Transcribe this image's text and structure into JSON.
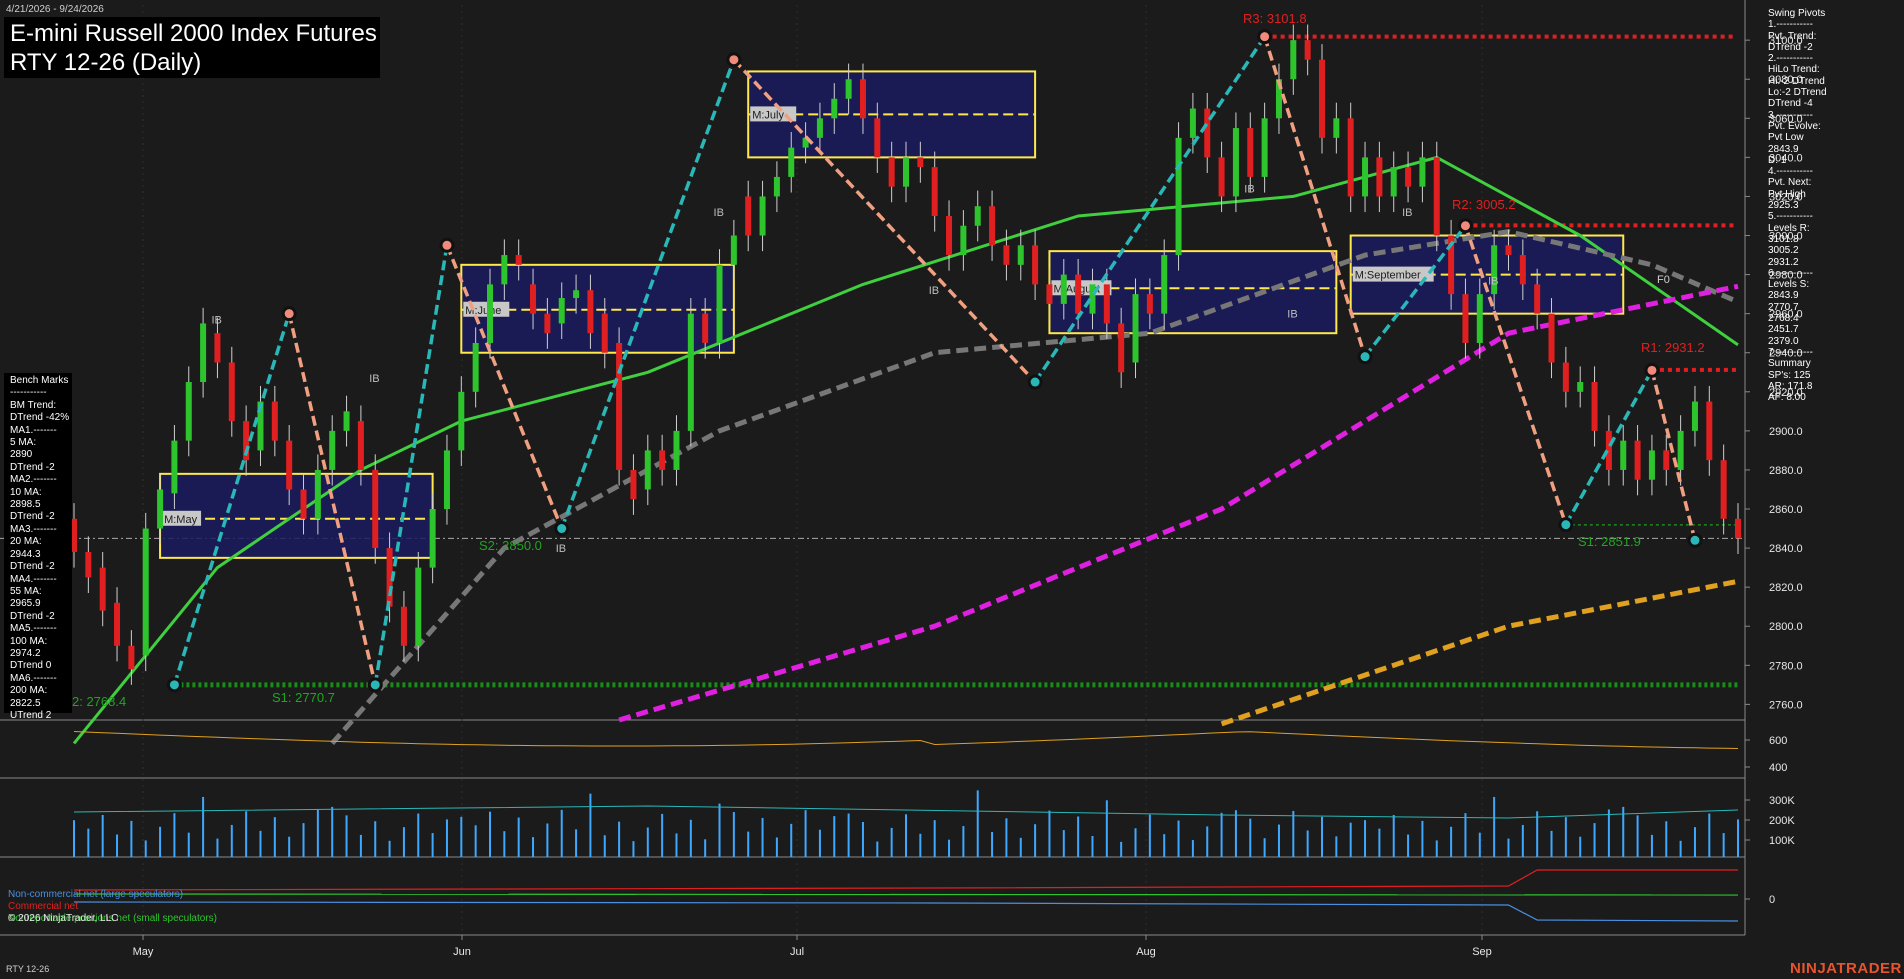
{
  "header": {
    "date_range": "4/21/2026 - 9/24/2026",
    "title_line1": "E-mini Russell 2000 Index Futures",
    "title_line2": "RTY 12-26 (Daily)"
  },
  "benchmarks": {
    "title": "Bench Marks",
    "lines": [
      "-----------",
      "BM Trend:",
      "DTrend -42%",
      "MA1.-------",
      "5 MA:",
      "2890",
      "DTrend -2",
      "MA2.-------",
      "10 MA:",
      "2898.5",
      "DTrend -2",
      "MA3.-------",
      "20 MA:",
      "2944.3",
      "DTrend -2",
      "MA4.-------",
      "55 MA:",
      "2965.9",
      "DTrend -2",
      "MA5.-------",
      "100 MA:",
      "2974.2",
      "DTrend 0",
      "MA6.-------",
      "200 MA:",
      "2822.5",
      "UTrend 2"
    ]
  },
  "swing_pivots": {
    "lines": [
      "Swing Pivots",
      "1.-----------",
      "Pvt. Trend:",
      "DTrend -2",
      "2.-----------",
      "HiLo Trend:",
      "Hi:-2 DTrend",
      "Lo:-2 DTrend",
      "DTrend -4",
      "3.-----------",
      "Pvt. Evolve:",
      "Pvt Low",
      "2843.9",
      "D: 1",
      "4.-----------",
      "Pvt. Next:",
      "Pvt High",
      "2925.3",
      "5.-----------",
      "Levels R:",
      "3101.8",
      "3005.2",
      "2931.2",
      "6.-----------",
      "Levels S:",
      "2843.9",
      "2770.7",
      "2768.4",
      "2451.7",
      "2379.0",
      "7.-----------",
      "Summary",
      "SP's: 125",
      "AR: 171.8",
      "AF: 8.00"
    ]
  },
  "level_labels": {
    "r3": "R3: 3101.8",
    "r2": "R2: 3005.2",
    "r1": "R1: 2931.2",
    "s2": "S2: 2850.0",
    "s1_left": "S1: 2770.7",
    "s2_left": "2: 2768.4",
    "s1_right": "S1: 2851.9"
  },
  "month_boxes": [
    "M:May",
    "M:June",
    "M:July",
    "M:August",
    "M:September"
  ],
  "markers": {
    "ib": "IB",
    "f0": "F0"
  },
  "x_axis": [
    "May",
    "Jun",
    "Jul",
    "Aug",
    "Sep"
  ],
  "price_axis": [
    "3100.0",
    "3080.0",
    "3060.0",
    "3040.0",
    "3020.0",
    "3000.0",
    "2980.0",
    "2960.0",
    "2940.0",
    "2920.0",
    "2900.0",
    "2880.0",
    "2860.0",
    "2840.0",
    "2820.0",
    "2800.0",
    "2780.0",
    "2760.0"
  ],
  "panel2_axis": [
    "600",
    "400"
  ],
  "panel3_axis": [
    "300K",
    "200K",
    "100K"
  ],
  "panel4_axis": [
    "0"
  ],
  "legend": {
    "noncommercial": "Non-commercial net (large speculators)",
    "commercial": "Commercial net",
    "nonreportable": "Nonreportable positions net (small speculators)"
  },
  "copyright": "© 2026 NinjaTrader, LLC",
  "footer_symbol": "RTY 12-26",
  "brand": "NINJATRADER",
  "colors": {
    "up": "#2ec42e",
    "down": "#e02020",
    "pivot_up": "#2ab7b7",
    "pivot_down": "#f0a080",
    "ma20": "#3fcf3f",
    "ma55": "#777777",
    "ma100": "#e020e0",
    "ma200": "#e0a020",
    "resistance": "#e02020",
    "support": "#1a8c1a",
    "box": "#ffe94a"
  },
  "chart_data": {
    "type": "candlestick",
    "title": "E-mini Russell 2000 Index Futures RTY 12-26 (Daily)",
    "x_range": [
      "2026-04-21",
      "2026-09-24"
    ],
    "ylim": [
      2752,
      3118
    ],
    "candles": [
      {
        "o": 2855,
        "c": 2838
      },
      {
        "o": 2838,
        "c": 2825
      },
      {
        "o": 2830,
        "c": 2808
      },
      {
        "o": 2812,
        "c": 2790
      },
      {
        "o": 2790,
        "c": 2778
      },
      {
        "o": 2785,
        "c": 2850
      },
      {
        "o": 2850,
        "c": 2870
      },
      {
        "o": 2868,
        "c": 2895
      },
      {
        "o": 2895,
        "c": 2925
      },
      {
        "o": 2925,
        "c": 2955
      },
      {
        "o": 2950,
        "c": 2935
      },
      {
        "o": 2935,
        "c": 2905
      },
      {
        "o": 2905,
        "c": 2885
      },
      {
        "o": 2890,
        "c": 2915
      },
      {
        "o": 2915,
        "c": 2895
      },
      {
        "o": 2895,
        "c": 2870
      },
      {
        "o": 2870,
        "c": 2855
      },
      {
        "o": 2855,
        "c": 2880
      },
      {
        "o": 2880,
        "c": 2900
      },
      {
        "o": 2900,
        "c": 2910
      },
      {
        "o": 2905,
        "c": 2880
      },
      {
        "o": 2880,
        "c": 2840
      },
      {
        "o": 2840,
        "c": 2810
      },
      {
        "o": 2810,
        "c": 2790
      },
      {
        "o": 2790,
        "c": 2830
      },
      {
        "o": 2830,
        "c": 2860
      },
      {
        "o": 2860,
        "c": 2890
      },
      {
        "o": 2890,
        "c": 2920
      },
      {
        "o": 2920,
        "c": 2945
      },
      {
        "o": 2945,
        "c": 2975
      },
      {
        "o": 2975,
        "c": 2990
      },
      {
        "o": 2990,
        "c": 2985
      },
      {
        "o": 2975,
        "c": 2960
      },
      {
        "o": 2960,
        "c": 2950
      },
      {
        "o": 2955,
        "c": 2968
      },
      {
        "o": 2968,
        "c": 2972
      },
      {
        "o": 2972,
        "c": 2950
      },
      {
        "o": 2960,
        "c": 2940
      },
      {
        "o": 2945,
        "c": 2880
      },
      {
        "o": 2880,
        "c": 2865
      },
      {
        "o": 2870,
        "c": 2890
      },
      {
        "o": 2890,
        "c": 2880
      },
      {
        "o": 2880,
        "c": 2900
      },
      {
        "o": 2900,
        "c": 2960
      },
      {
        "o": 2960,
        "c": 2945
      },
      {
        "o": 2945,
        "c": 2985
      },
      {
        "o": 2985,
        "c": 3000
      },
      {
        "o": 3020,
        "c": 3000
      },
      {
        "o": 3000,
        "c": 3020
      },
      {
        "o": 3020,
        "c": 3030
      },
      {
        "o": 3030,
        "c": 3045
      },
      {
        "o": 3045,
        "c": 3050
      },
      {
        "o": 3050,
        "c": 3060
      },
      {
        "o": 3060,
        "c": 3070
      },
      {
        "o": 3070,
        "c": 3080
      },
      {
        "o": 3080,
        "c": 3060
      },
      {
        "o": 3060,
        "c": 3040
      },
      {
        "o": 3040,
        "c": 3025
      },
      {
        "o": 3025,
        "c": 3040
      },
      {
        "o": 3040,
        "c": 3035
      },
      {
        "o": 3035,
        "c": 3010
      },
      {
        "o": 3010,
        "c": 2990
      },
      {
        "o": 2990,
        "c": 3005
      },
      {
        "o": 3005,
        "c": 3015
      },
      {
        "o": 3015,
        "c": 2995
      },
      {
        "o": 2995,
        "c": 2985
      },
      {
        "o": 2985,
        "c": 2995
      },
      {
        "o": 2995,
        "c": 2975
      },
      {
        "o": 2975,
        "c": 2965
      },
      {
        "o": 2965,
        "c": 2980
      },
      {
        "o": 2980,
        "c": 2960
      },
      {
        "o": 2960,
        "c": 2975
      },
      {
        "o": 2975,
        "c": 2955
      },
      {
        "o": 2955,
        "c": 2930
      },
      {
        "o": 2935,
        "c": 2970
      },
      {
        "o": 2970,
        "c": 2960
      },
      {
        "o": 2960,
        "c": 2990
      },
      {
        "o": 2990,
        "c": 3050
      },
      {
        "o": 3050,
        "c": 3065
      },
      {
        "o": 3065,
        "c": 3040
      },
      {
        "o": 3040,
        "c": 3020
      },
      {
        "o": 3020,
        "c": 3055
      },
      {
        "o": 3055,
        "c": 3030
      },
      {
        "o": 3030,
        "c": 3060
      },
      {
        "o": 3060,
        "c": 3080
      },
      {
        "o": 3080,
        "c": 3100
      },
      {
        "o": 3100,
        "c": 3090
      },
      {
        "o": 3090,
        "c": 3050
      },
      {
        "o": 3050,
        "c": 3060
      },
      {
        "o": 3060,
        "c": 3020
      },
      {
        "o": 3020,
        "c": 3040
      },
      {
        "o": 3040,
        "c": 3020
      },
      {
        "o": 3020,
        "c": 3035
      },
      {
        "o": 3035,
        "c": 3025
      },
      {
        "o": 3025,
        "c": 3040
      },
      {
        "o": 3040,
        "c": 3000
      },
      {
        "o": 3000,
        "c": 2970
      },
      {
        "o": 2970,
        "c": 2945
      },
      {
        "o": 2945,
        "c": 2970
      },
      {
        "o": 2970,
        "c": 2995
      },
      {
        "o": 2995,
        "c": 2990
      },
      {
        "o": 2990,
        "c": 2975
      },
      {
        "o": 2975,
        "c": 2960
      },
      {
        "o": 2960,
        "c": 2935
      },
      {
        "o": 2935,
        "c": 2920
      },
      {
        "o": 2920,
        "c": 2925
      },
      {
        "o": 2925,
        "c": 2900
      },
      {
        "o": 2900,
        "c": 2880
      },
      {
        "o": 2880,
        "c": 2895
      },
      {
        "o": 2895,
        "c": 2875
      },
      {
        "o": 2875,
        "c": 2890
      },
      {
        "o": 2890,
        "c": 2880
      },
      {
        "o": 2880,
        "c": 2900
      },
      {
        "o": 2900,
        "c": 2915
      },
      {
        "o": 2915,
        "c": 2885
      },
      {
        "o": 2885,
        "c": 2855
      },
      {
        "o": 2855,
        "c": 2845
      }
    ],
    "moving_averages": [
      {
        "name": "20 MA",
        "color": "#3fcf3f",
        "points": [
          [
            0,
            2740
          ],
          [
            10,
            2830
          ],
          [
            20,
            2880
          ],
          [
            27,
            2905
          ],
          [
            40,
            2930
          ],
          [
            55,
            2975
          ],
          [
            70,
            3010
          ],
          [
            85,
            3020
          ],
          [
            95,
            3040
          ],
          [
            105,
            3000
          ],
          [
            116,
            2944
          ]
        ]
      },
      {
        "name": "55 MA",
        "color": "#777777",
        "points": [
          [
            18,
            2740
          ],
          [
            30,
            2840
          ],
          [
            45,
            2900
          ],
          [
            60,
            2940
          ],
          [
            75,
            2950
          ],
          [
            90,
            2990
          ],
          [
            100,
            3002
          ],
          [
            110,
            2985
          ],
          [
            116,
            2966
          ]
        ]
      },
      {
        "name": "100 MA",
        "color": "#e020e0",
        "points": [
          [
            38,
            2752
          ],
          [
            60,
            2800
          ],
          [
            80,
            2860
          ],
          [
            100,
            2950
          ],
          [
            116,
            2974
          ]
        ]
      },
      {
        "name": "200 MA",
        "color": "#e0a020",
        "points": [
          [
            80,
            2750
          ],
          [
            100,
            2800
          ],
          [
            116,
            2823
          ]
        ]
      }
    ],
    "levels": {
      "R3": 3101.8,
      "R2": 3005.2,
      "R1": 2931.2,
      "S2": 2850.0,
      "S1": 2851.9,
      "S1_left": 2770.7
    },
    "swing_pivots": [
      [
        7,
        2770
      ],
      [
        15,
        2960
      ],
      [
        21,
        2770
      ],
      [
        26,
        2995
      ],
      [
        34,
        2850
      ],
      [
        46,
        3090
      ],
      [
        67,
        2925
      ],
      [
        83,
        3101.8
      ],
      [
        90,
        2938
      ],
      [
        97,
        3005
      ],
      [
        104,
        2852
      ],
      [
        110,
        2931
      ],
      [
        113,
        2844
      ]
    ],
    "month_boxes": [
      {
        "label": "M:May",
        "x0": 6,
        "x1": 25,
        "hi": 2878,
        "lo": 2835,
        "mid": 2855
      },
      {
        "label": "M:June",
        "x0": 27,
        "x1": 46,
        "hi": 2985,
        "lo": 2940,
        "mid": 2962
      },
      {
        "label": "M:July",
        "x0": 47,
        "x1": 67,
        "hi": 3084,
        "lo": 3040,
        "mid": 3062
      },
      {
        "label": "M:August",
        "x0": 68,
        "x1": 88,
        "hi": 2992,
        "lo": 2950,
        "mid": 2973
      },
      {
        "label": "M:September",
        "x0": 89,
        "x1": 108,
        "hi": 3000,
        "lo": 2960,
        "mid": 2980
      }
    ],
    "panels": {
      "oi_range": [
        300,
        700
      ],
      "volume_range": [
        0,
        380000
      ],
      "cot": {
        "noncommercial": [
          -5,
          -5,
          -6,
          -8,
          -10,
          -14
        ],
        "commercial": [
          5,
          5,
          6,
          8,
          10,
          14
        ],
        "nonreportable": [
          0,
          0,
          0,
          0,
          0,
          0
        ]
      }
    }
  }
}
